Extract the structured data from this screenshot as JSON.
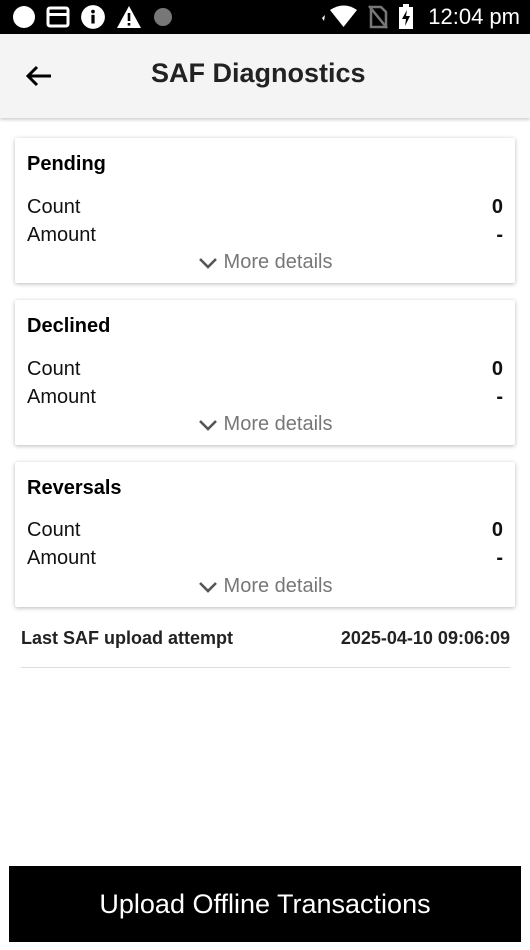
{
  "status_bar": {
    "time": "12:04 pm",
    "icons": [
      "circle-icon",
      "card-icon",
      "info-icon",
      "warning-icon",
      "dot-icon",
      "wifi-icon",
      "no-sim-icon",
      "battery-charging-icon"
    ]
  },
  "app_bar": {
    "back_icon": "arrow-left-icon",
    "title": "SAF Diagnostics"
  },
  "cards": [
    {
      "title": "Pending",
      "count_label": "Count",
      "count_value": "0",
      "amount_label": "Amount",
      "amount_value": "-",
      "more_label": "More details"
    },
    {
      "title": "Declined",
      "count_label": "Count",
      "count_value": "0",
      "amount_label": "Amount",
      "amount_value": "-",
      "more_label": "More details"
    },
    {
      "title": "Reversals",
      "count_label": "Count",
      "count_value": "0",
      "amount_label": "Amount",
      "amount_value": "-",
      "more_label": "More details"
    }
  ],
  "last_upload": {
    "label": "Last SAF upload attempt",
    "value": "2025-04-10 09:06:09"
  },
  "upload_button": {
    "label": "Upload Offline Transactions"
  },
  "colors": {
    "status_bar": "#000000",
    "app_bar": "#f4f4f4",
    "button": "#000000",
    "muted_text": "#777777"
  }
}
